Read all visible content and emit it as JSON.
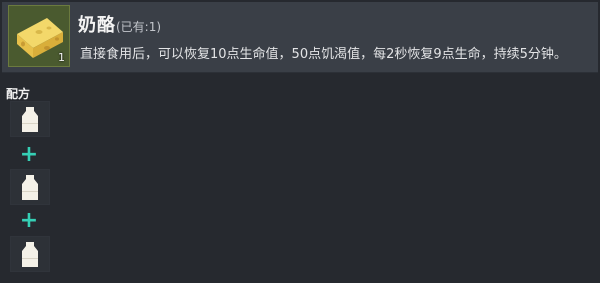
{
  "item": {
    "name": "奶酪",
    "owned": "(已有:1)",
    "quantity": "1",
    "description": "直接食用后，可以恢复10点生命值，50点饥渴值，每2秒恢复9点生命，持续5分钟。",
    "icon": "cheese-icon"
  },
  "recipe": {
    "title": "配方",
    "ingredients": [
      {
        "icon": "milk-bottle-icon"
      },
      {
        "icon": "milk-bottle-icon"
      },
      {
        "icon": "milk-bottle-icon"
      }
    ],
    "plus_symbol": "+"
  },
  "colors": {
    "background": "#26292f",
    "card": "#3a3f47",
    "plus": "#35cfb5",
    "slot_border": "#6b7a3f"
  }
}
